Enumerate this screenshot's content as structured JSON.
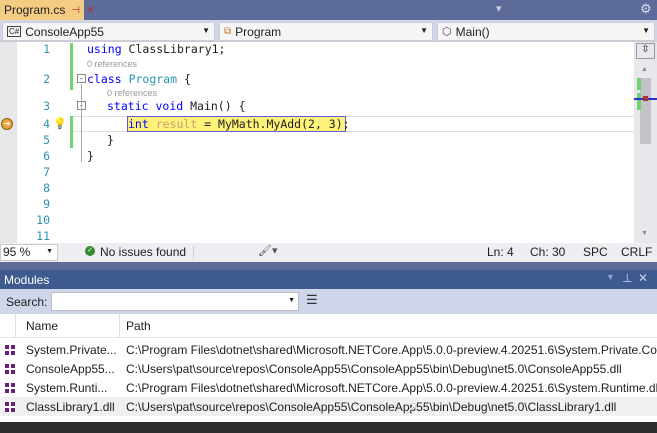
{
  "tab": {
    "title": "Program.cs",
    "pin": "⊣",
    "close": "✕"
  },
  "titlebar": {
    "dropdown": "▾",
    "settings": "⚙"
  },
  "nav": {
    "project": "ConsoleApp55",
    "project_icon": "C#",
    "type": "Program",
    "member": "Main()"
  },
  "editor": {
    "line_numbers": [
      "1",
      "2",
      "3",
      "4",
      "5",
      "6",
      "7",
      "8",
      "9",
      "10",
      "11"
    ],
    "codelens": [
      "0 references",
      "0 references"
    ],
    "code": {
      "l1a": "using",
      "l1b": " ClassLibrary1;",
      "l2a": "class",
      "l2b": "Program",
      "l2c": " {",
      "l3a": "static",
      "l3b": "void",
      "l3c": " Main() {",
      "l4a": "int",
      "l4b": " result",
      "l4c": " = MyMath.MyAdd(2, 3);",
      "l5": "}",
      "l6": "}"
    }
  },
  "status": {
    "zoom": "95 %",
    "issues": "No issues found",
    "ln": "Ln: 4",
    "ch": "Ch: 30",
    "spc": "SPC",
    "crlf": "CRLF"
  },
  "modules": {
    "title": "Modules",
    "search_label": "Search:",
    "search_value": "",
    "columns": [
      "Name",
      "Path"
    ],
    "rows": [
      {
        "name": "System.Private...",
        "path": "C:\\Program Files\\dotnet\\shared\\Microsoft.NETCore.App\\5.0.0-preview.4.20251.6\\System.Private.CoreLib.dll"
      },
      {
        "name": "ConsoleApp55...",
        "path": "C:\\Users\\pat\\source\\repos\\ConsoleApp55\\ConsoleApp55\\bin\\Debug\\net5.0\\ConsoleApp55.dll"
      },
      {
        "name": "System.Runti...",
        "path": "C:\\Program Files\\dotnet\\shared\\Microsoft.NETCore.App\\5.0.0-preview.4.20251.6\\System.Runtime.dll"
      },
      {
        "name": "ClassLibrary1.dll",
        "path": "C:\\Users\\pat\\source\\repos\\ConsoleApp55\\ConsoleApp55\\bin\\Debug\\net5.0\\ClassLibrary1.dll"
      }
    ]
  }
}
